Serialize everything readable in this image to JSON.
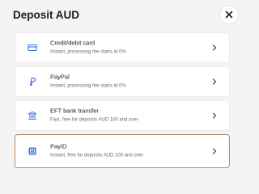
{
  "dialog": {
    "title": "Deposit AUD"
  },
  "options": [
    {
      "label": "Credit/debit card",
      "description": "Instant, processing fee starts at 0%",
      "icon": "credit-card-icon",
      "selected": false
    },
    {
      "label": "PayPal",
      "description": "Instant, processing fee starts at 0%",
      "icon": "paypal-icon",
      "selected": false
    },
    {
      "label": "EFT bank transfer",
      "description": "Fast, free for deposits AUD 100 and over",
      "icon": "bank-icon",
      "selected": false
    },
    {
      "label": "PayID",
      "description": "Instant, free for deposits AUD 100 and over",
      "icon": "payid-icon",
      "selected": true
    }
  ],
  "colors": {
    "selected_border": "#b98a5a",
    "icon_blue": "#3b6fd8"
  }
}
